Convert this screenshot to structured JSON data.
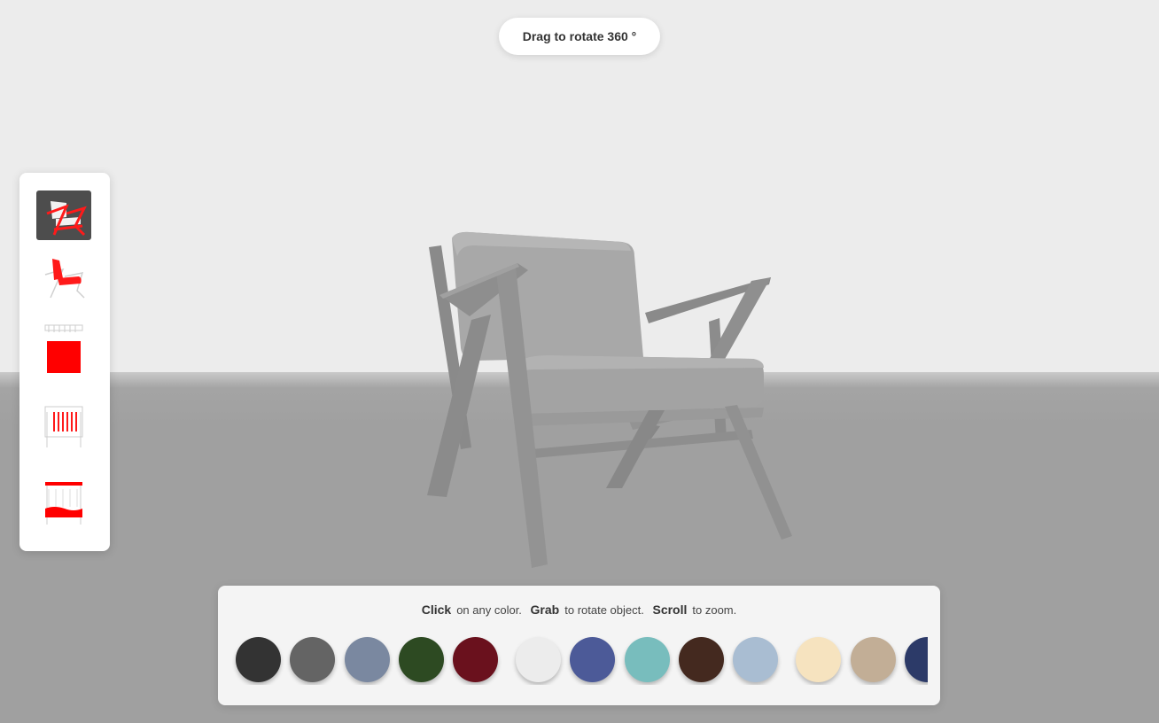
{
  "viewer": {
    "rotate_hint": "Drag to rotate 360 °"
  },
  "parts": [
    {
      "name": "frame",
      "active": true
    },
    {
      "name": "seat-back-cushion",
      "active": false
    },
    {
      "name": "back-cushion",
      "active": false
    },
    {
      "name": "back-straps",
      "active": false
    },
    {
      "name": "seat-straps",
      "active": false
    }
  ],
  "colors": {
    "wall": "#ececec",
    "floor": "#a0a0a0",
    "accent": "#ff0000",
    "active_part_bg": "#4d4d4d"
  },
  "instructions": {
    "click_label": "Click",
    "click_text": "on any color.",
    "grab_label": "Grab",
    "grab_text": "to rotate object.",
    "scroll_label": "Scroll",
    "scroll_text": "to zoom."
  },
  "swatches": [
    "#333333",
    "#646464",
    "#7a88a0",
    "#2d4a22",
    "#6a111d",
    "#ececec",
    "#4c5a98",
    "#78bdbd",
    "#44291f",
    "#a9bdd2",
    "#f6e3bf",
    "#c2ae96",
    "#2c3a68"
  ]
}
